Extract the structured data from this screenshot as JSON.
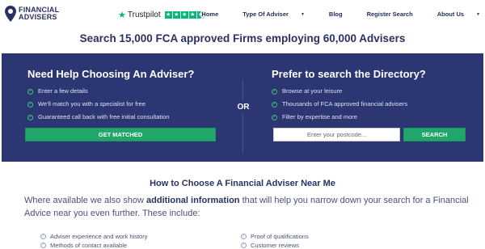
{
  "header": {
    "brand_line1": "FINANCIAL",
    "brand_line2": "ADVISERS",
    "trustpilot": "Trustpilot",
    "trustpilot_rating": 4.5,
    "menu": [
      {
        "label": "Home",
        "has_dropdown": false
      },
      {
        "label": "Type Of Adviser",
        "has_dropdown": true
      },
      {
        "label": "Blog",
        "has_dropdown": false
      },
      {
        "label": "Register Search",
        "has_dropdown": false
      },
      {
        "label": "About Us",
        "has_dropdown": true
      }
    ]
  },
  "headline": "Search 15,000 FCA approved Firms employing 60,000 Advisers",
  "help": {
    "title": "Need Help Choosing An Adviser?",
    "items": [
      "Enter a few details",
      "We'll match you with a specialist for free",
      "Guaranteed call back with free initial consultation"
    ],
    "button": "GET MATCHED"
  },
  "or_label": "OR",
  "directory": {
    "title": "Prefer to search the Directory?",
    "items": [
      "Browse at your leisure",
      "Thousands of FCA approved financial advisers",
      "Filter by expertise and more"
    ],
    "placeholder": "Enter your postcode...",
    "button": "SEARCH"
  },
  "how": {
    "title": "How to Choose A Financial Adviser Near Me",
    "para_before": "Where available we also show ",
    "para_bold": "additional information",
    "para_after": " that will help you narrow down your search for a Financial Advice near you even further. These include:",
    "features": [
      "Adviser experience and work history",
      "Proof of qualifications",
      "Methods of contact available",
      "Customer reviews"
    ]
  },
  "colors": {
    "panel": "#2b3672",
    "accent_green": "#21a76a",
    "trustpilot_green": "#00b67a",
    "navy_text": "#2a3163"
  }
}
